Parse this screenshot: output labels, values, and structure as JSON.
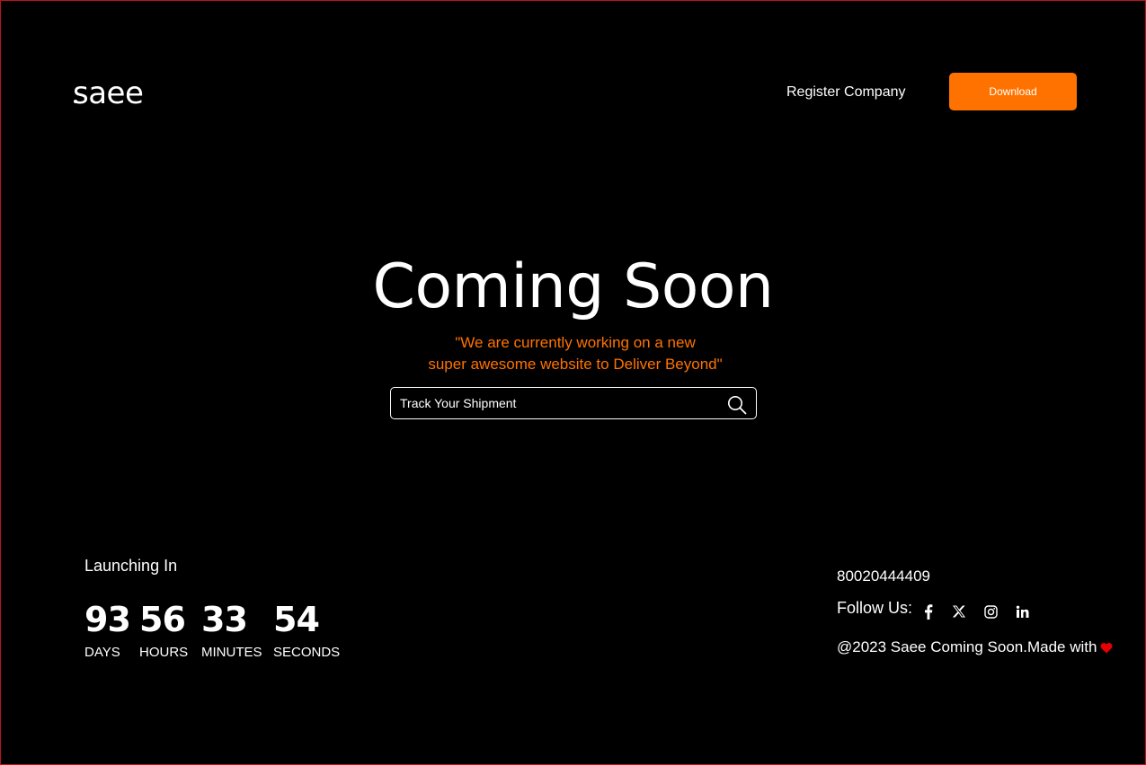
{
  "header": {
    "logo_text": "saee",
    "register_label": "Register Company",
    "download_label": "Download"
  },
  "hero": {
    "title": "Coming Soon",
    "subtitle_line1": "\"We are currently working on a new",
    "subtitle_line2": "super awesome website to Deliver Beyond\"",
    "track_placeholder": "Track Your Shipment"
  },
  "countdown": {
    "label": "Launching In",
    "units": [
      {
        "value": "93",
        "label": "DAYS"
      },
      {
        "value": "56",
        "label": "HOURS"
      },
      {
        "value": "33",
        "label": "MINUTES"
      },
      {
        "value": "54",
        "label": "SECONDS"
      }
    ]
  },
  "contact": {
    "phone": "80020444409",
    "follow_label": "Follow Us:",
    "social_icons": [
      "facebook-icon",
      "x-icon",
      "instagram-icon",
      "linkedin-icon"
    ],
    "copyright": "@2023 Saee Coming Soon.Made with"
  },
  "colors": {
    "accent": "#ff7200",
    "background": "#000000",
    "heart": "#e60000",
    "frame_border": "#c0121b"
  }
}
